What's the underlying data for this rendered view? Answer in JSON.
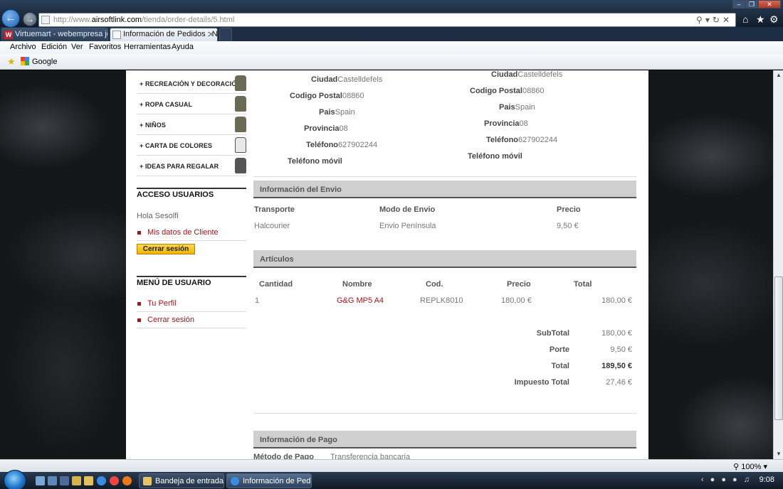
{
  "browser": {
    "url_prefix": "http://www.",
    "url_domain": "airsoftlink.com",
    "url_path": "/tienda/order-details/5.html",
    "tabs": [
      {
        "label": "Virtuemart - webempresa joo..."
      },
      {
        "label": "Información de Pedidos : N..."
      }
    ],
    "menu": [
      "Archivo",
      "Edición",
      "Ver",
      "Favoritos",
      "Herramientas",
      "Ayuda"
    ],
    "favorites": {
      "google_label": "Google"
    },
    "zoom": "100%"
  },
  "sidebar": {
    "categories": [
      {
        "label": "+ RECREACIÓN Y DECORACIÓN"
      },
      {
        "label": "+ ROPA CASUAL"
      },
      {
        "label": "+ NIÑOS"
      },
      {
        "label": "+ CARTA DE COLORES"
      },
      {
        "label": "+ IDEAS PARA REGALAR"
      }
    ],
    "access": {
      "title": "ACCESO USUARIOS",
      "greeting": "Hola Sesolfi",
      "my_data_link": "Mis datos de Cliente",
      "logout_button": "Cerrar sesión"
    },
    "user_menu": {
      "title": "MENÚ DE USUARIO",
      "profile_link": "Tu Perfil",
      "logout_link": "Cerrar sesión"
    }
  },
  "billing_address": {
    "rows": [
      {
        "label": "Ciudad",
        "value": "Castelldefels"
      },
      {
        "label": "Codigo Postal",
        "value": "08860"
      },
      {
        "label": "Pais",
        "value": "Spain"
      },
      {
        "label": "Provincia",
        "value": "08"
      },
      {
        "label": "Teléfono",
        "value": "627902244"
      },
      {
        "label": "Teléfono móvil",
        "value": ""
      }
    ]
  },
  "shipping_address": {
    "rows": [
      {
        "label": "Ciudad",
        "value": "Castelldefels"
      },
      {
        "label": "Codigo Postal",
        "value": "08860"
      },
      {
        "label": "Pais",
        "value": "Spain"
      },
      {
        "label": "Provincia",
        "value": "08"
      },
      {
        "label": "Teléfono",
        "value": "627902244"
      },
      {
        "label": "Teléfono móvil",
        "value": ""
      }
    ]
  },
  "shipping_info": {
    "title": "Información del Envio",
    "headers": [
      "Transporte",
      "Modo de Envio",
      "Precio"
    ],
    "row": {
      "carrier": "Halcourier",
      "mode": "Envio Península",
      "price": "9,50 €"
    }
  },
  "articles": {
    "title": "Artículos",
    "headers": [
      "Cantidad",
      "Nombre",
      "Cod.",
      "Precio",
      "Total"
    ],
    "rows": [
      {
        "qty": "1",
        "name": "G&G MP5 A4",
        "code": "REPLK8010",
        "price": "180,00 €",
        "total": "180,00 €"
      }
    ],
    "totals": [
      {
        "label": "SubTotal",
        "value": "180,00 €"
      },
      {
        "label": "Porte",
        "value": "9,50 €"
      },
      {
        "label": "Total",
        "value": "189,50 €"
      },
      {
        "label": "Impuesto Total",
        "value": "27,46 €"
      }
    ]
  },
  "payment_info": {
    "title": "Información de Pago",
    "method_label": "Método de Pago",
    "method_value": "Transferencia bancaria"
  },
  "taskbar": {
    "tasks": [
      {
        "label": "Bandeja de entrada ..."
      },
      {
        "label": "Información de Pedi..."
      }
    ],
    "clock": "9:08"
  }
}
